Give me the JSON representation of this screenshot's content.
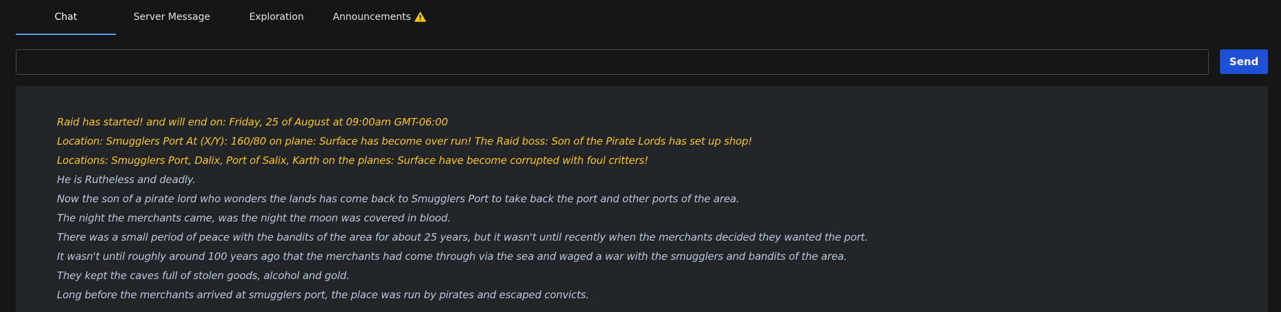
{
  "tabs": [
    {
      "label": "Chat",
      "active": true
    },
    {
      "label": "Server Message",
      "active": false
    },
    {
      "label": "Exploration",
      "active": false
    },
    {
      "label": "Announcements",
      "active": false,
      "icon": "warning-icon"
    }
  ],
  "chat": {
    "input_value": "",
    "send_label": "Send"
  },
  "messages": [
    {
      "text": "Raid has started! and will end on: Friday, 25 of August at 09:00am GMT-06:00",
      "type": "event"
    },
    {
      "text": "Location: Smugglers Port At (X/Y): 160/80 on plane: Surface has become over run! The Raid boss: Son of the Pirate Lords has set up shop!",
      "type": "event"
    },
    {
      "text": "Locations: Smugglers Port, Dalix, Port of Salix, Karth on the planes: Surface have become corrupted with foul critters!",
      "type": "event"
    },
    {
      "text": "He is Rutheless and deadly.",
      "type": "lore"
    },
    {
      "text": "Now the son of a pirate lord who wonders the lands has come back to Smugglers Port to take back the port and other ports of the area.",
      "type": "lore"
    },
    {
      "text": "The night the merchants came, was the night the moon was covered in blood.",
      "type": "lore"
    },
    {
      "text": "There was a small period of peace with the bandits of the area for about 25 years, but it wasn't until recently when the merchants decided they wanted the port.",
      "type": "lore"
    },
    {
      "text": "It wasn't until roughly around 100 years ago that the merchants had come through via the sea and waged a war with the smugglers and bandits of the area.",
      "type": "lore"
    },
    {
      "text": "They kept the caves full of stolen goods, alcohol and gold.",
      "type": "lore"
    },
    {
      "text": "Long before the merchants arrived at smugglers port, the place was run by pirates and escaped convicts.",
      "type": "lore"
    }
  ],
  "colors": {
    "event_text": "#f5c518",
    "lore_text": "#b8c7dc",
    "accent": "#5b9cf0",
    "send_button": "#1f4fd4",
    "warning_icon": "#f5c518"
  }
}
